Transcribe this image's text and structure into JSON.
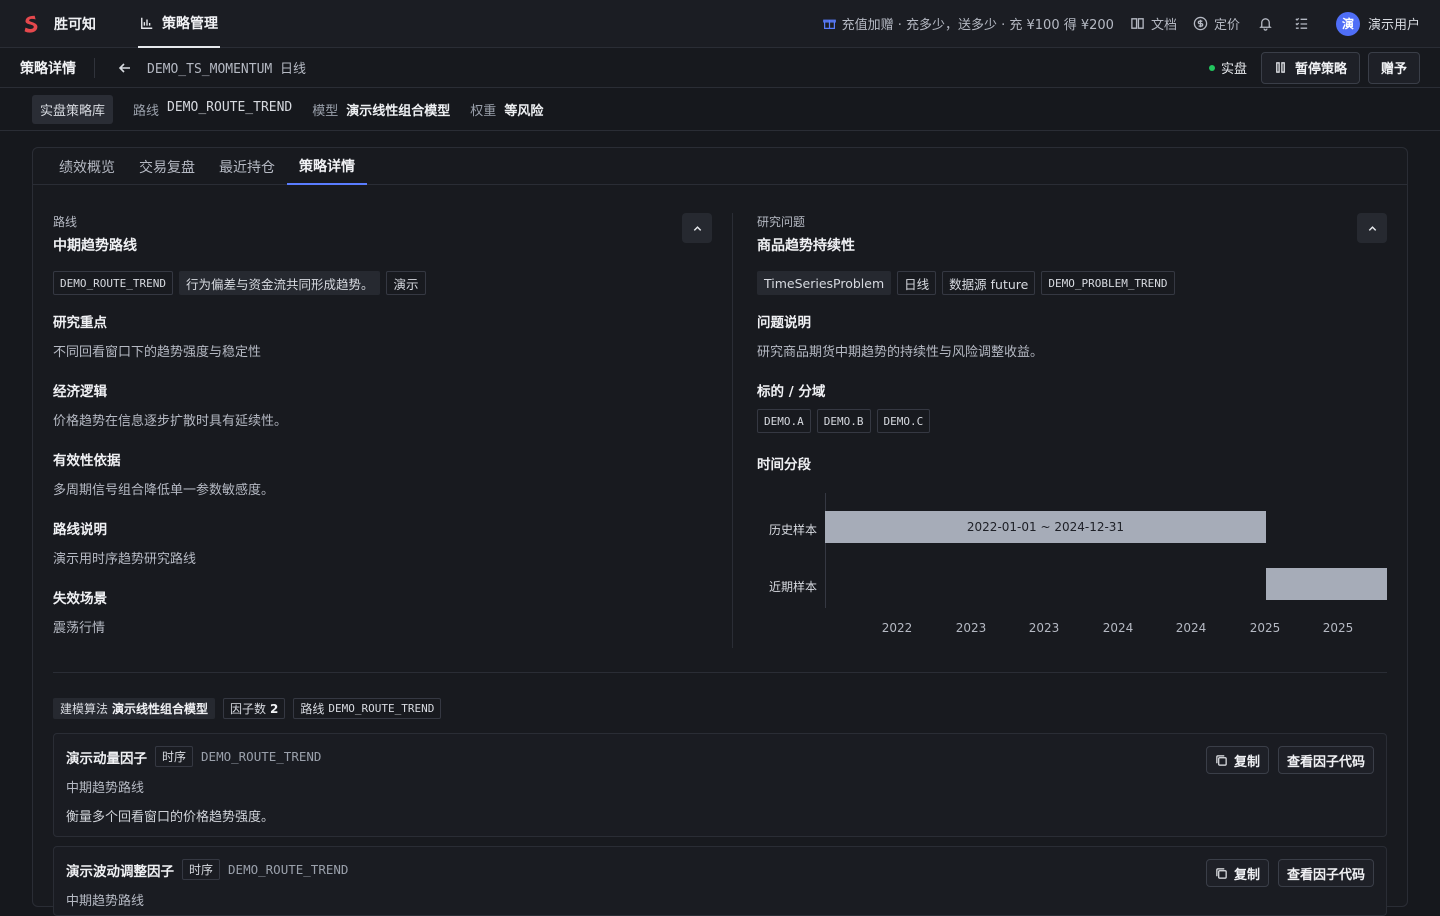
{
  "app": {
    "name": "胜可知"
  },
  "nav": {
    "active_tab": "策略管理"
  },
  "top": {
    "promo": "充值加赠 · 充多少，送多少 · 充 ¥100 得 ¥200",
    "docs": "文档",
    "pricing": "定价",
    "user_avatar": "演",
    "user_name": "演示用户"
  },
  "subheader": {
    "title": "策略详情",
    "strategy_id": "DEMO_TS_MOMENTUM 日线",
    "status": "实盘",
    "pause_label": "暂停策略",
    "gift_label": "赠予"
  },
  "crumbs": {
    "library": "实盘策略库",
    "route_key": "路线",
    "route_val": "DEMO_ROUTE_TREND",
    "model_key": "模型",
    "model_val": "演示线性组合模型",
    "weight_key": "权重",
    "weight_val": "等风险"
  },
  "tabs": [
    "绩效概览",
    "交易复盘",
    "最近持仓",
    "策略详情"
  ],
  "left": {
    "label": "路线",
    "title": "中期趋势路线",
    "tags": [
      "DEMO_ROUTE_TREND",
      "行为偏差与资金流共同形成趋势。",
      "演示"
    ],
    "sections": [
      {
        "h": "研究重点",
        "t": "不同回看窗口下的趋势强度与稳定性"
      },
      {
        "h": "经济逻辑",
        "t": "价格趋势在信息逐步扩散时具有延续性。"
      },
      {
        "h": "有效性依据",
        "t": "多周期信号组合降低单一参数敏感度。"
      },
      {
        "h": "路线说明",
        "t": "演示用时序趋势研究路线"
      },
      {
        "h": "失效场景",
        "t": "震荡行情"
      }
    ]
  },
  "right": {
    "label": "研究问题",
    "title": "商品趋势持续性",
    "tags": [
      "TimeSeriesProblem",
      "日线",
      "数据源 future",
      "DEMO_PROBLEM_TREND"
    ],
    "problem_h": "问题说明",
    "problem_t": "研究商品期货中期趋势的持续性与风险调整收益。",
    "symbols_h": "标的 / 分域",
    "symbols": [
      "DEMO.A",
      "DEMO.B",
      "DEMO.C"
    ],
    "timeline_h": "时间分段",
    "timeline": {
      "rows": [
        {
          "label": "历史样本",
          "start": "2022-01-01",
          "end": "2024-12-31",
          "text": "2022-01-01 ~ 2024-12-31"
        },
        {
          "label": "近期样本",
          "start": "2025-01-01",
          "end": "2025-10-15",
          "text": ""
        }
      ],
      "ticks": [
        "2022",
        "2023",
        "2023",
        "2024",
        "2024",
        "2025",
        "2025"
      ],
      "bar_color": "#a6acb8"
    }
  },
  "model": {
    "algo_key": "建模算法",
    "algo_val": "演示线性组合模型",
    "factor_count_key": "因子数",
    "factor_count_val": "2",
    "route_key": "路线",
    "route_val": "DEMO_ROUTE_TREND"
  },
  "factors": [
    {
      "name": "演示动量因子",
      "type": "时序",
      "route": "DEMO_ROUTE_TREND",
      "sub": "中期趋势路线",
      "desc": "衡量多个回看窗口的价格趋势强度。"
    },
    {
      "name": "演示波动调整因子",
      "type": "时序",
      "route": "DEMO_ROUTE_TREND",
      "sub": "中期趋势路线",
      "desc": ""
    }
  ],
  "factor_actions": {
    "copy": "复制",
    "view_code": "查看因子代码"
  }
}
